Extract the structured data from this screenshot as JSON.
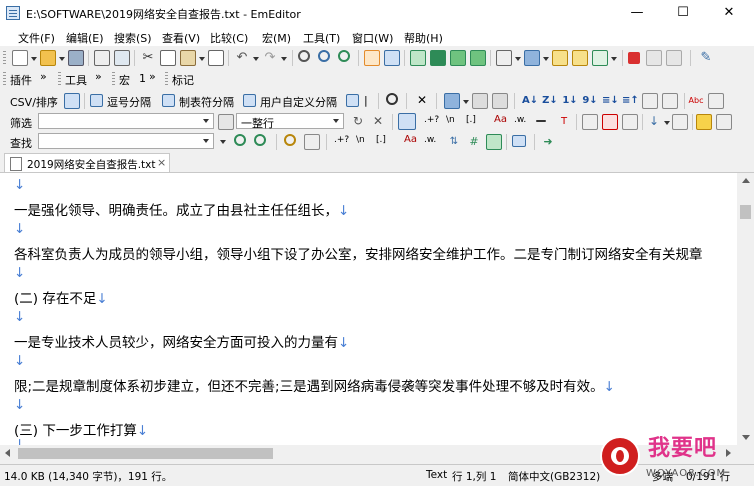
{
  "window": {
    "title": "E:\\SOFTWARE\\2019网络安全自查报告.txt - EmEditor",
    "minimize": "—",
    "maximize": "☐",
    "close": "✕"
  },
  "menu": [
    {
      "label": "文件(F)"
    },
    {
      "label": "编辑(E)"
    },
    {
      "label": "搜索(S)"
    },
    {
      "label": "查看(V)"
    },
    {
      "label": "比较(C)"
    },
    {
      "label": "宏(M)"
    },
    {
      "label": "工具(T)"
    },
    {
      "label": "窗口(W)"
    },
    {
      "label": "帮助(H)"
    }
  ],
  "bars": {
    "plugins": "插件",
    "tools": "工具",
    "macro": "宏",
    "macro_num": "1",
    "marks": "标记",
    "chevron": "»"
  },
  "csv_bar": {
    "csv_sort": "CSV/排序",
    "comma": "逗号分隔",
    "tab": "制表符分隔",
    "user": "用户自定义分隔",
    "pipe": "|"
  },
  "filter_bar": {
    "label": "筛选",
    "value": "",
    "mode": "一整行"
  },
  "find_bar": {
    "label": "查找",
    "value": ""
  },
  "icon_text": {
    "regex_dot": ".+?",
    "newline": "\\n",
    "bracket": "[.]",
    "case": "Aa",
    "word": ".w.",
    "abc": "Abc"
  },
  "document_tab": {
    "label": "2019网络安全自查报告.txt",
    "close": "×"
  },
  "editor": {
    "arrow": "↓",
    "lines": [
      "",
      "一是强化领导、明确责任。成立了由县社主任任组长，",
      "",
      "各科室负责人为成员的领导小组，领导小组下设了办公室，安排网络安全维护工作。二是专门制订网络安全有关规章",
      "",
      "(二) 存在不足",
      "",
      "一是专业技术人员较少，网络安全方面可投入的力量有",
      "",
      "限;二是规章制度体系初步建立，但还不完善;三是遇到网络病毒侵袭等突发事件处理不够及时有效。",
      "",
      "(三) 下一步工作打算",
      ""
    ]
  },
  "status": {
    "size": "14.0 KB (14,340 字节)，191 行。",
    "mode": "Text",
    "position": "行 1,列 1",
    "encoding": "简体中文(GB2312)",
    "extra1": "多端",
    "extra2": "0/191 行"
  },
  "watermark": {
    "brand": "我要吧",
    "domain": "WOYAO8.COM"
  },
  "colors": {
    "arrow": "#4a7fd4",
    "accent": "#3a6ea5"
  }
}
